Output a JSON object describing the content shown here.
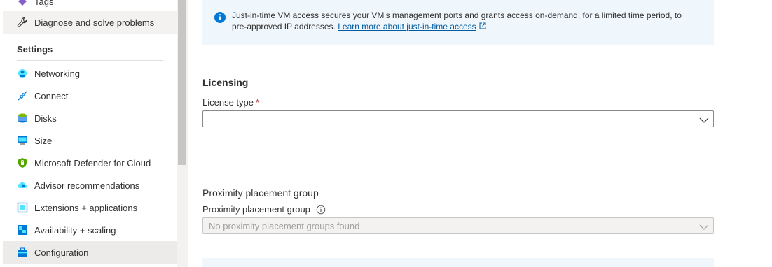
{
  "sidebar": {
    "partial_item": {
      "label": "Tags"
    },
    "diagnose": {
      "label": "Diagnose and solve problems"
    },
    "section_title": "Settings",
    "items": [
      {
        "label": "Networking"
      },
      {
        "label": "Connect"
      },
      {
        "label": "Disks"
      },
      {
        "label": "Size"
      },
      {
        "label": "Microsoft Defender for Cloud"
      },
      {
        "label": "Advisor recommendations"
      },
      {
        "label": "Extensions + applications"
      },
      {
        "label": "Availability + scaling"
      },
      {
        "label": "Configuration"
      }
    ]
  },
  "main": {
    "info": {
      "text": "Just-in-time VM access secures your VM's management ports and grants access on-demand, for a limited time period, to pre-approved IP addresses.",
      "link": "Learn more about just-in-time access"
    },
    "licensing": {
      "heading": "Licensing",
      "label": "License type",
      "required_mark": "*",
      "value": ""
    },
    "proximity": {
      "heading": "Proximity placement group",
      "label": "Proximity placement group",
      "placeholder": "No proximity placement groups found"
    }
  },
  "colors": {
    "accent": "#0078d4",
    "info_bg": "#eff6fc",
    "selected_bg": "#edebe9",
    "required": "#a4262c"
  }
}
